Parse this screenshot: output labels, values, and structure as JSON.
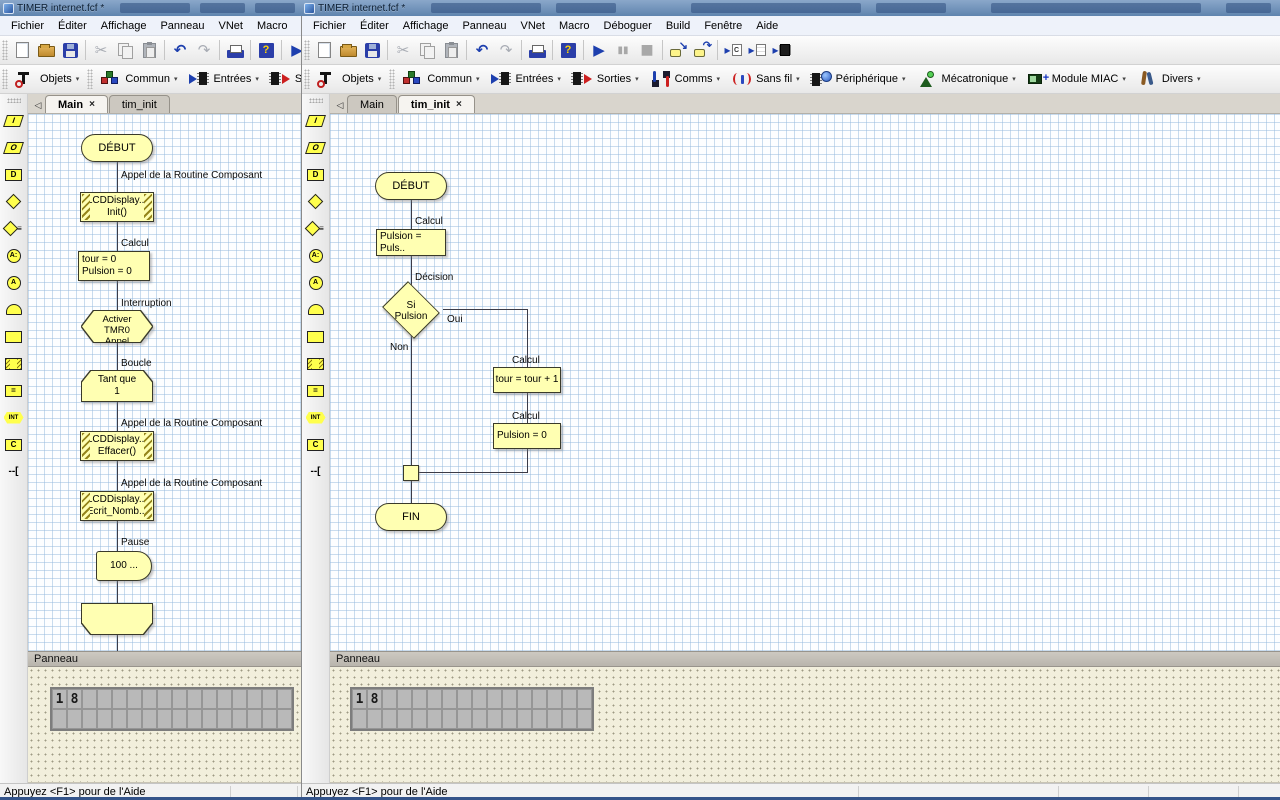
{
  "window_title": "TIMER internet.fcf *",
  "menus": [
    "Fichier",
    "Éditer",
    "Affichage",
    "Panneau",
    "VNet",
    "Macro",
    "Déboguer",
    "Build",
    "Fenêtre",
    "Aide"
  ],
  "icons": {
    "cut": "✂",
    "undo": "↶",
    "redo": "↷",
    "help": "?",
    "run": "▶",
    "pause": "▮▮",
    "stop": "■",
    "step_into": "↘",
    "step_over": "↷",
    "compile_arrow": "▸",
    "c_letter": "C",
    "dropdown": "▾",
    "tab_close": "×",
    "tab_scroll": "◁",
    "plus": "+"
  },
  "component_buttons": [
    {
      "label": "Objets"
    },
    {
      "label": "Commun"
    },
    {
      "label": "Entrées"
    },
    {
      "label": "Sorties"
    },
    {
      "label": "Comms"
    },
    {
      "label": "Sans fil"
    },
    {
      "label": "Périphérique"
    },
    {
      "label": "Mécatronique"
    },
    {
      "label": "Module MIAC"
    },
    {
      "label": "Divers"
    }
  ],
  "palette": [
    {
      "name": "input",
      "shape": "para",
      "glyph": "I"
    },
    {
      "name": "output",
      "shape": "para",
      "glyph": "O"
    },
    {
      "name": "delay",
      "shape": "rect",
      "glyph": "D"
    },
    {
      "name": "decision",
      "shape": "diamond",
      "glyph": ""
    },
    {
      "name": "switch",
      "shape": "diamond",
      "glyph": "",
      "suffix": "≡"
    },
    {
      "name": "connection-point",
      "shape": "circle",
      "glyph": "A:"
    },
    {
      "name": "goto-connection",
      "shape": "circle",
      "glyph": "A"
    },
    {
      "name": "loop",
      "shape": "arch",
      "glyph": ""
    },
    {
      "name": "macro",
      "shape": "rect",
      "glyph": ""
    },
    {
      "name": "component-macro",
      "shape": "rect-hatched",
      "glyph": ""
    },
    {
      "name": "calculation",
      "shape": "rect",
      "glyph": "="
    },
    {
      "name": "interrupt",
      "shape": "hex",
      "glyph": "INT"
    },
    {
      "name": "c-code",
      "shape": "rect",
      "glyph": "C"
    },
    {
      "name": "comment",
      "shape": "bracket",
      "glyph": "--["
    }
  ],
  "windows": {
    "left": {
      "tabs": [
        {
          "label": "Main"
        },
        {
          "label": "tim_init"
        }
      ],
      "panneau_title": "Panneau",
      "lcd": "18",
      "status": "Appuyez <F1> pour de l'Aide",
      "chart": {
        "begin": "DÉBUT",
        "nodes": [
          {
            "label": "Appel de la Routine Composant",
            "text": "LCDDisplay...\nInit()"
          },
          {
            "label": "Calcul",
            "text": "tour = 0\nPulsion = 0"
          },
          {
            "label": "Interruption",
            "text": "Activer\nTMR0\nAppel"
          },
          {
            "label": "Boucle",
            "text": "Tant que\n1"
          },
          {
            "label": "Appel de la Routine Composant",
            "text": "LCDDisplay...\nEffacer()"
          },
          {
            "label": "Appel de la Routine Composant",
            "text": "LCDDisplay...\nEcrit_Nomb..."
          },
          {
            "label": "Pause",
            "text": "100 ..."
          }
        ]
      }
    },
    "right": {
      "tabs": [
        {
          "label": "Main"
        },
        {
          "label": "tim_init"
        }
      ],
      "panneau_title": "Panneau",
      "lcd": "18",
      "status": "Appuyez <F1> pour de l'Aide",
      "chart": {
        "begin": "DÉBUT",
        "end": "FIN",
        "calc1_label": "Calcul",
        "calc1": "Pulsion = Puls..",
        "decision_label": "Décision",
        "decision": "Si\nPulsion",
        "yes": "Oui",
        "no": "Non",
        "calc2_label": "Calcul",
        "calc2": "tour = tour + 1",
        "calc3_label": "Calcul",
        "calc3": "Pulsion = 0"
      }
    }
  }
}
